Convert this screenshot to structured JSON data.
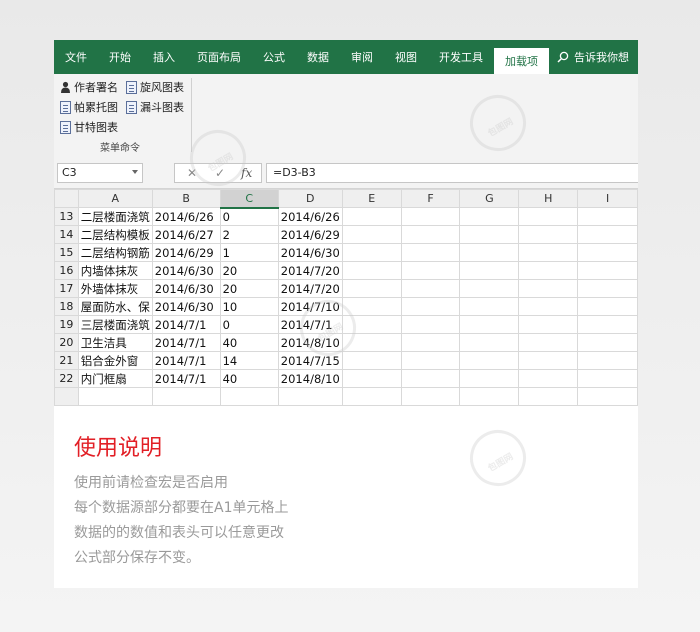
{
  "ribbon": {
    "tabs": [
      "文件",
      "开始",
      "插入",
      "页面布局",
      "公式",
      "数据",
      "审阅",
      "视图",
      "开发工具",
      "加载项"
    ],
    "active_tab": "加载项",
    "tell_me": "告诉我你想",
    "buttons": [
      "作者署名",
      "旋风图表",
      "帕累托图",
      "漏斗图表",
      "甘特图表"
    ],
    "group_label": "菜单命令"
  },
  "formula_bar": {
    "name_box": "C3",
    "cancel_symbol": "✕",
    "enter_symbol": "✓",
    "fx_symbol": "fx",
    "formula": "=D3-B3"
  },
  "sheet": {
    "columns": [
      "A",
      "B",
      "C",
      "D",
      "E",
      "F",
      "G",
      "H",
      "I"
    ],
    "rows": [
      {
        "num": "13",
        "a": "二层楼面浇筑",
        "b": "2014/6/26",
        "c": "0",
        "d": "2014/6/26"
      },
      {
        "num": "14",
        "a": "二层结构模板",
        "b": "2014/6/27",
        "c": "2",
        "d": "2014/6/29"
      },
      {
        "num": "15",
        "a": "二层结构钢筋",
        "b": "2014/6/29",
        "c": "1",
        "d": "2014/6/30"
      },
      {
        "num": "16",
        "a": "内墙体抹灰",
        "b": "2014/6/30",
        "c": "20",
        "d": "2014/7/20"
      },
      {
        "num": "17",
        "a": "外墙体抹灰",
        "b": "2014/6/30",
        "c": "20",
        "d": "2014/7/20"
      },
      {
        "num": "18",
        "a": "屋面防水、保",
        "b": "2014/6/30",
        "c": "10",
        "d": "2014/7/10"
      },
      {
        "num": "19",
        "a": "三层楼面浇筑",
        "b": "2014/7/1",
        "c": "0",
        "d": "2014/7/1"
      },
      {
        "num": "20",
        "a": "卫生洁具",
        "b": "2014/7/1",
        "c": "40",
        "d": "2014/8/10"
      },
      {
        "num": "21",
        "a": "铝合金外窗",
        "b": "2014/7/1",
        "c": "14",
        "d": "2014/7/15"
      },
      {
        "num": "22",
        "a": "内门框扇",
        "b": "2014/7/1",
        "c": "40",
        "d": "2014/8/10"
      }
    ]
  },
  "help": {
    "title": "使用说明",
    "lines": [
      "使用前请检查宏是否启用",
      "每个数据源部分都要在A1单元格上",
      "数据的的数值和表头可以任意更改",
      "公式部分保存不变。"
    ]
  },
  "watermark": "包图网",
  "colors": {
    "excel_green": "#217346",
    "title_red": "#e21f26",
    "help_text": "#9a9a9a"
  }
}
